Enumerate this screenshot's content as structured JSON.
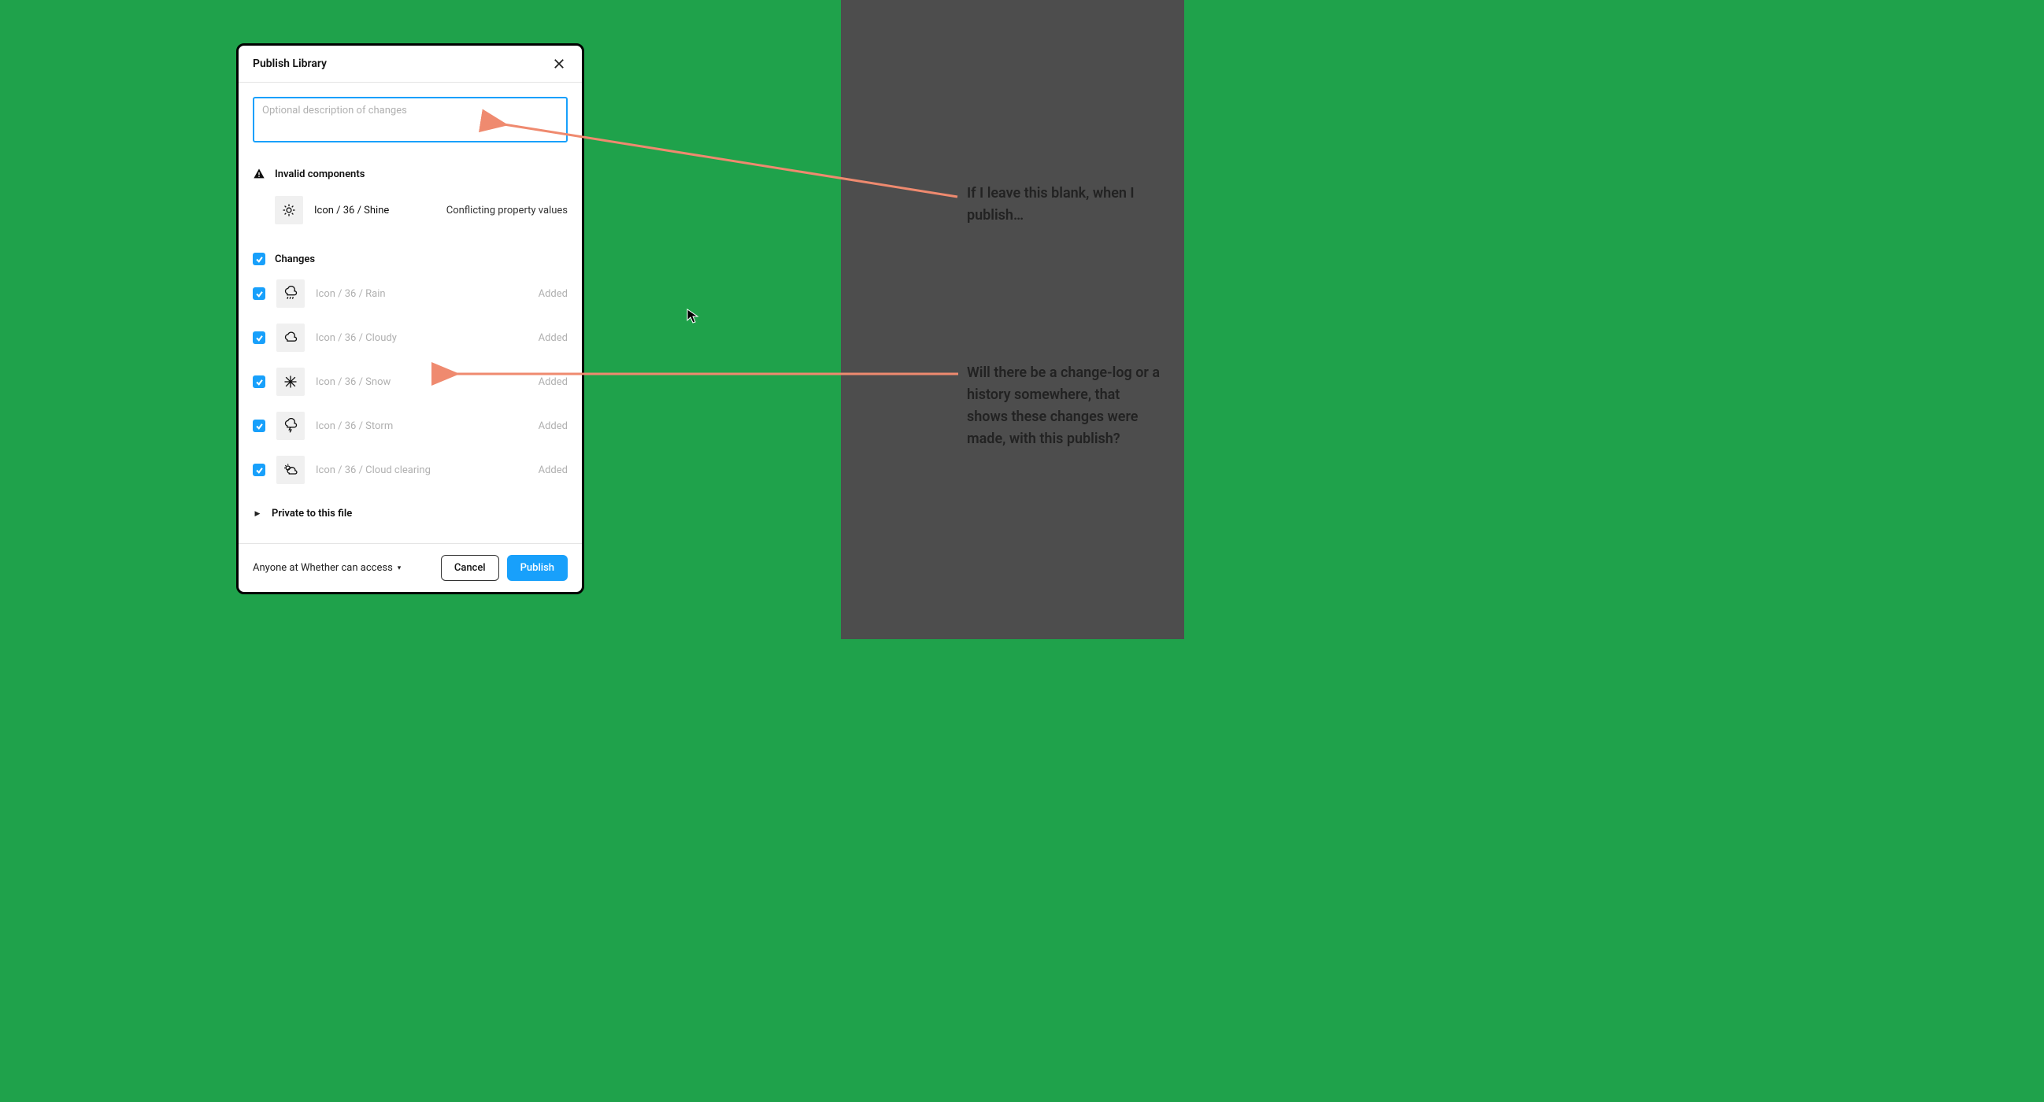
{
  "dialog": {
    "title": "Publish Library",
    "description_placeholder": "Optional description of changes",
    "invalid": {
      "heading": "Invalid components",
      "item": {
        "name": "Icon / 36 / Shine",
        "reason": "Conflicting property values",
        "icon": "shine-icon"
      }
    },
    "changes": {
      "heading": "Changes",
      "items": [
        {
          "name": "Icon / 36 / Rain",
          "status": "Added",
          "icon": "rain-icon"
        },
        {
          "name": "Icon / 36 / Cloudy",
          "status": "Added",
          "icon": "cloudy-icon"
        },
        {
          "name": "Icon / 36 / Snow",
          "status": "Added",
          "icon": "snow-icon"
        },
        {
          "name": "Icon / 36 / Storm",
          "status": "Added",
          "icon": "storm-icon"
        },
        {
          "name": "Icon / 36 / Cloud clearing",
          "status": "Added",
          "icon": "cloud-clearing-icon"
        }
      ]
    },
    "private_heading": "Private to this file",
    "access_label": "Anyone at Whether can access",
    "cancel_label": "Cancel",
    "publish_label": "Publish"
  },
  "annotations": {
    "a1": "If I leave this blank, when I publish…",
    "a2": "Will there be a change-log or a history somewhere, that shows these changes were made, with this publish?"
  },
  "colors": {
    "accent": "#18a0fb",
    "arrow": "#ef8a6f",
    "bg_green": "#1fa24b",
    "bg_gray": "#4d4d4d"
  }
}
